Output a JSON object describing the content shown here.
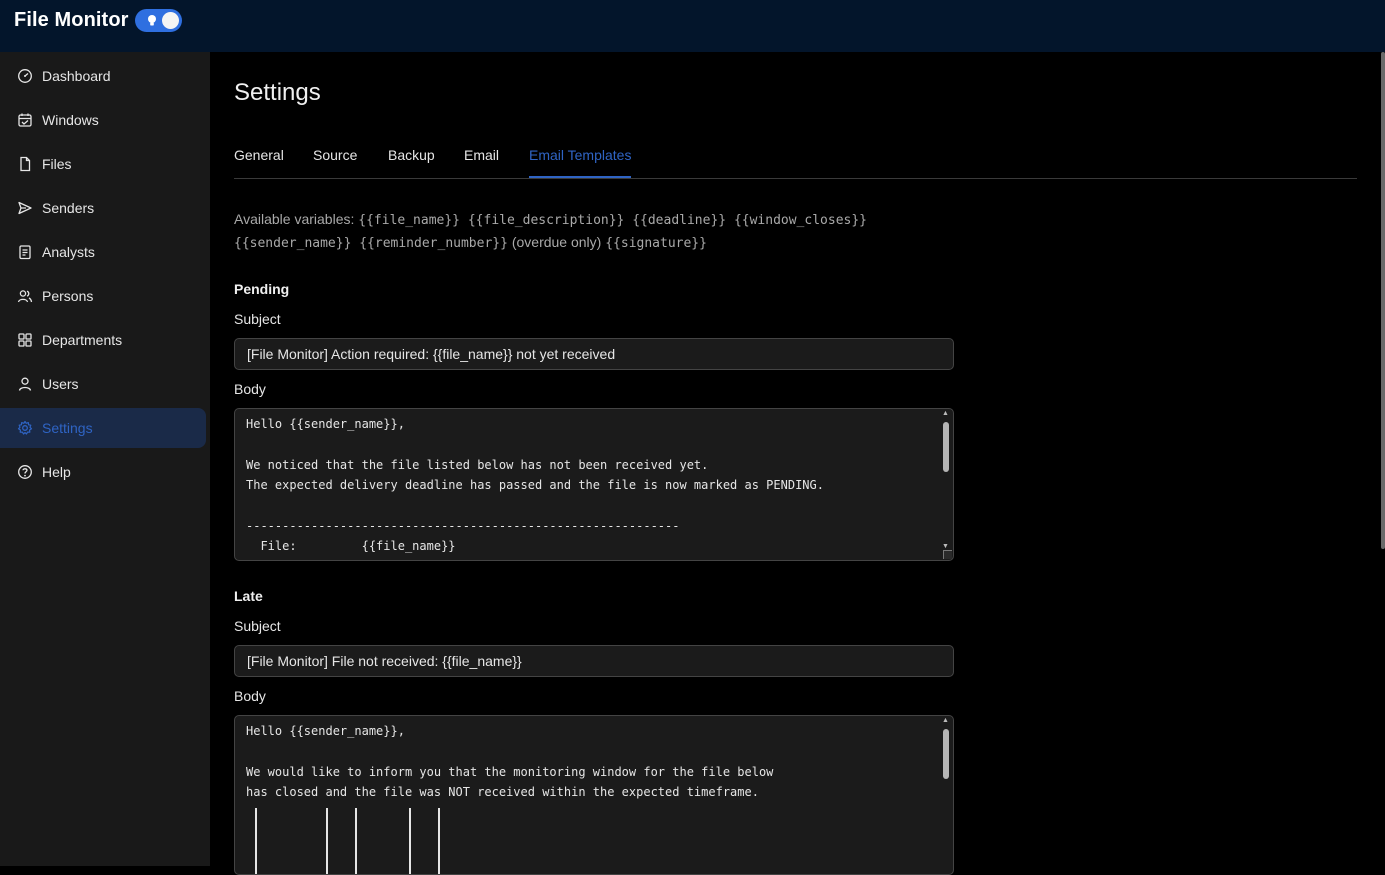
{
  "app": {
    "title": "File Monitor",
    "toggle_icon": "lightbulb-icon"
  },
  "sidebar": {
    "items": [
      {
        "label": "Dashboard",
        "icon": "gauge-icon"
      },
      {
        "label": "Windows",
        "icon": "calendar-icon"
      },
      {
        "label": "Files",
        "icon": "file-icon"
      },
      {
        "label": "Senders",
        "icon": "send-icon"
      },
      {
        "label": "Analysts",
        "icon": "clipboard-icon"
      },
      {
        "label": "Persons",
        "icon": "people-icon"
      },
      {
        "label": "Departments",
        "icon": "grid-icon"
      },
      {
        "label": "Users",
        "icon": "user-icon"
      },
      {
        "label": "Settings",
        "icon": "gear-icon",
        "active": true
      },
      {
        "label": "Help",
        "icon": "help-icon"
      }
    ]
  },
  "page": {
    "title": "Settings"
  },
  "tabs": [
    {
      "label": "General"
    },
    {
      "label": "Source"
    },
    {
      "label": "Backup"
    },
    {
      "label": "Email"
    },
    {
      "label": "Email Templates",
      "active": true
    }
  ],
  "variables": {
    "label": "Available variables:",
    "line1_vars": "{{file_name}} {{file_description}} {{deadline}} {{window_closes}}",
    "line2_vars_a": "{{sender_name}} {{reminder_number}}",
    "line2_note": "(overdue only)",
    "line2_vars_b": "{{signature}}"
  },
  "templates": {
    "pending": {
      "title": "Pending",
      "subject_label": "Subject",
      "subject_value": "[File Monitor] Action required: {{file_name}} not yet received",
      "body_label": "Body",
      "body_value": "Hello {{sender_name}},\n\nWe noticed that the file listed below has not been received yet.\nThe expected delivery deadline has passed and the file is now marked as PENDING.\n\n------------------------------------------------------------\n  File:         {{file_name}}"
    },
    "late": {
      "title": "Late",
      "subject_label": "Subject",
      "subject_value": "[File Monitor] File not received: {{file_name}}",
      "body_label": "Body",
      "body_value": "Hello {{sender_name}},\n\nWe would like to inform you that the monitoring window for the file below\nhas closed and the file was NOT received within the expected timeframe."
    }
  },
  "colors": {
    "accent": "#2f64c4",
    "topbar": "#03152b",
    "sidebar": "#191919",
    "active_bg": "#1a2a48"
  }
}
